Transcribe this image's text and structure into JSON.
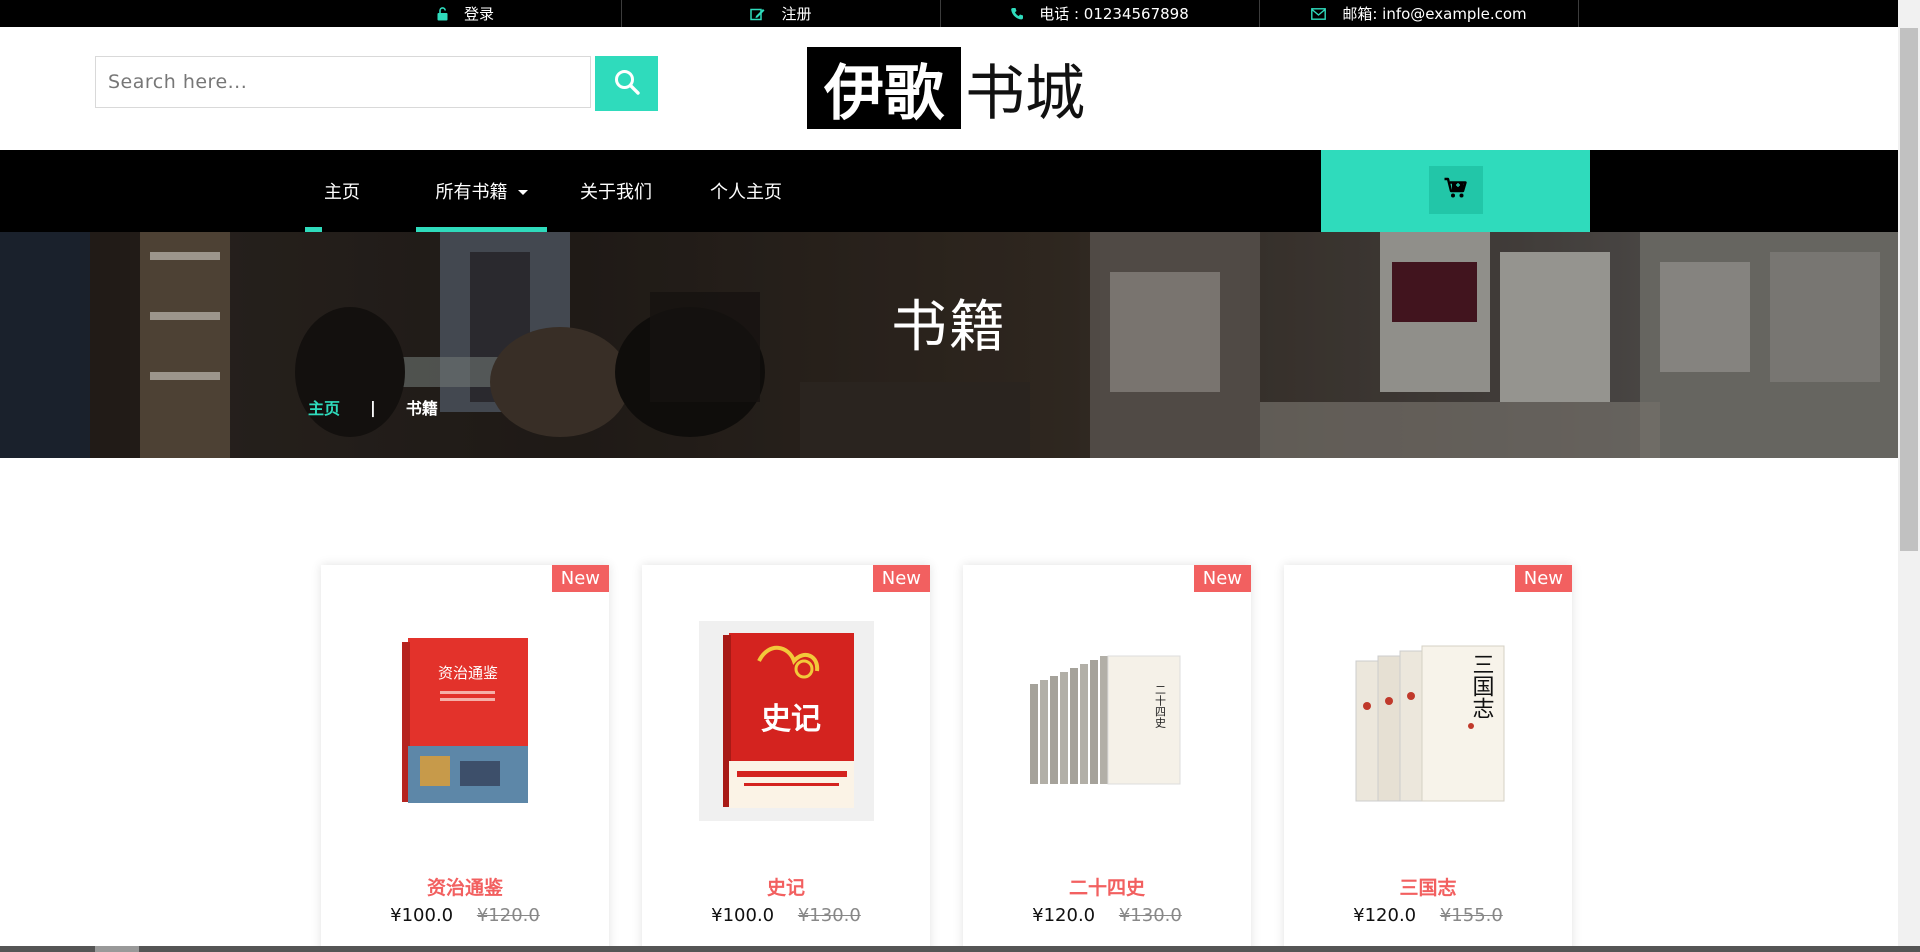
{
  "topbar": {
    "login_label": "登录",
    "register_label": "注册",
    "phone_label": "电话 : 01234567898",
    "email_label": "邮箱: info@example.com"
  },
  "header": {
    "search_placeholder": "Search here...",
    "logo_black": "伊歌",
    "logo_white": "书城"
  },
  "nav": {
    "items": [
      {
        "label": "主页"
      },
      {
        "label": "所有书籍"
      },
      {
        "label": "关于我们"
      },
      {
        "label": "个人主页"
      }
    ]
  },
  "banner": {
    "title": "书籍",
    "breadcrumb_home": "主页",
    "breadcrumb_sep": "|",
    "breadcrumb_current": "书籍"
  },
  "products": [
    {
      "badge": "New",
      "title": "资治通鉴",
      "price": "¥100.0",
      "old_price": "¥120.0",
      "cover_text": "资治通鉴"
    },
    {
      "badge": "New",
      "title": "史记",
      "price": "¥100.0",
      "old_price": "¥130.0",
      "cover_text": "史记"
    },
    {
      "badge": "New",
      "title": "二十四史",
      "price": "¥120.0",
      "old_price": "¥130.0",
      "cover_text": "二十四史"
    },
    {
      "badge": "New",
      "title": "三国志",
      "price": "¥120.0",
      "old_price": "¥155.0",
      "cover_text": "三国志"
    }
  ],
  "colors": {
    "accent": "#2fdbbc",
    "sale": "#f26060",
    "dark": "#000000"
  }
}
